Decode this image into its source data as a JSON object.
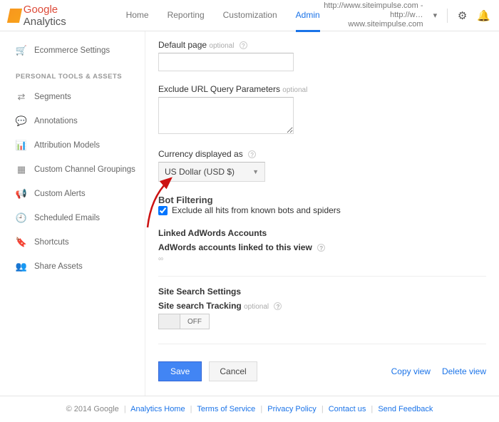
{
  "header": {
    "logo_google": "Google",
    "logo_product": " Analytics",
    "nav": {
      "home": "Home",
      "reporting": "Reporting",
      "customization": "Customization",
      "admin": "Admin"
    },
    "site_line1": "http://www.siteimpulse.com - http://w…",
    "site_line2": "www.siteimpulse.com",
    "caret": "▾"
  },
  "sidebar": {
    "ecommerce": "Ecommerce Settings",
    "section_pt": "PERSONAL TOOLS & ASSETS",
    "segments": "Segments",
    "annotations": "Annotations",
    "attribution": "Attribution Models",
    "ccg": "Custom Channel Groupings",
    "alerts": "Custom Alerts",
    "scheduled": "Scheduled Emails",
    "shortcuts": "Shortcuts",
    "share": "Share Assets"
  },
  "form": {
    "default_page_label": "Default page",
    "optional": "optional",
    "exclude_label": "Exclude URL Query Parameters",
    "currency_label": "Currency displayed as",
    "currency_value": "US Dollar (USD $)",
    "bot_title": "Bot Filtering",
    "bot_checkbox": "Exclude all hits from known bots and spiders",
    "linked_title": "Linked AdWords Accounts",
    "linked_sub": "AdWords accounts linked to this view",
    "linked_hint": "∞",
    "search_title": "Site Search Settings",
    "search_sub": "Site search Tracking",
    "toggle_off": "OFF",
    "save": "Save",
    "cancel": "Cancel",
    "copy": "Copy view",
    "delete": "Delete view"
  },
  "footer": {
    "copyright": "© 2014 Google",
    "links": [
      "Analytics Home",
      "Terms of Service",
      "Privacy Policy",
      "Contact us",
      "Send Feedback"
    ]
  }
}
